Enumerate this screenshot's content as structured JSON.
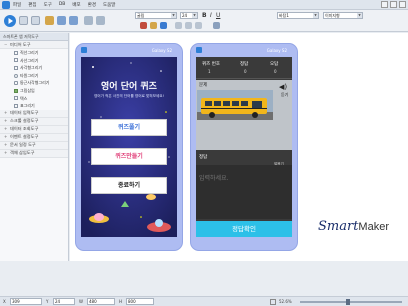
{
  "menu": [
    "파일",
    "편집",
    "도구",
    "DB",
    "배포",
    "환경",
    "도움말"
  ],
  "toolbar": {
    "font_name": "굴림",
    "font_size": "24",
    "style_select": "바탕1",
    "image_mode": "이미지형"
  },
  "panel": {
    "tab_label": "스마트폰 앱 저작도구",
    "categories": [
      {
        "label": "미디어 도구",
        "items": [
          "직선그리기",
          "사선그리기",
          "사각형그리기",
          "타원그리기",
          "둥근사각형그리기",
          "그림삽입",
          "텍스",
          "표그리기"
        ]
      },
      {
        "label": "데이터 입력도구"
      },
      {
        "label": "스크롤 설정도구"
      },
      {
        "label": "데이터 조회도구"
      },
      {
        "label": "이벤트 설정도구"
      },
      {
        "label": "문서 일정 도구"
      },
      {
        "label": "객체 삽입도구"
      }
    ]
  },
  "phone1": {
    "title": "Galaxy S2",
    "quiz_title": "영어 단어 퀴즈",
    "quiz_sub": "영어가 적은 사진의 단어를 영어로 맞혀보세요!",
    "btn_quiz": "퀴즈풀기",
    "btn_make": "퀴즈만들기",
    "btn_exit": "종료하기"
  },
  "phone2": {
    "title": "Galaxy S2",
    "col_no": "퀴즈 번호",
    "col_correct": "정답",
    "col_wrong": "오답",
    "val_no": "1",
    "val_correct": "0",
    "val_wrong": "0",
    "problem_label": "문제",
    "listen_label": "듣기",
    "answer_label": "정답",
    "hint_label": "발음기",
    "answer_placeholder": "입력하세요.",
    "confirm_btn": "정답확인"
  },
  "brand_script": "Smart",
  "brand_plain": "Maker",
  "statusbar": {
    "x": "309",
    "y": "24",
    "w": "480",
    "h": "800",
    "zoom": "52.6%"
  }
}
